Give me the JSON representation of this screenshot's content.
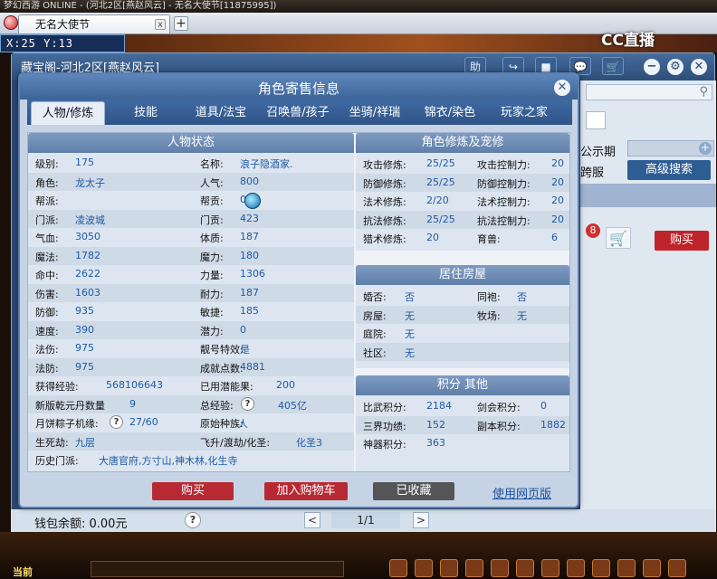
{
  "top_strip": "梦幻西游 ONLINE - (河北2区[燕赵风云] - 无名大使节[11875995])",
  "browser": {
    "tab_title": "无名大使节",
    "tab_close": "x",
    "new_tab": "+"
  },
  "coords": "X:25 Y:13",
  "watermark": "CC直播",
  "ig_window": {
    "title": "藏宝阁-河北2区[燕赵风云]",
    "icons": {
      "help": "助",
      "share": "↪",
      "stop": "■",
      "chat": "💬",
      "cart": "🛒",
      "minimize": "−",
      "settings": "⚙",
      "close": "✕"
    }
  },
  "right_panel": {
    "publicity_label": "公示期",
    "cross_server_label": "跨服",
    "advanced_search": "高级搜索",
    "badge_count": "8",
    "buy": "购买"
  },
  "bottom": {
    "wallet": "钱包余额: 0.00元",
    "help": "?",
    "prev": "<",
    "next": ">",
    "pager": "1/1"
  },
  "modal": {
    "title": "角色寄售信息",
    "close": "✕",
    "tabs": [
      "人物/修炼",
      "技能",
      "道具/法宝",
      "召唤兽/孩子",
      "坐骑/祥瑞",
      "锦衣/染色",
      "玩家之家"
    ],
    "status": {
      "header": "人物状态",
      "rows": [
        {
          "l1": "级别:",
          "v1": "175",
          "l2": "名称:",
          "v2": "浪子隐酒家."
        },
        {
          "l1": "角色:",
          "v1": "龙太子",
          "l2": "人气:",
          "v2": "800"
        },
        {
          "l1": "帮派:",
          "v1": "",
          "l2": "帮贡:",
          "v2": "0"
        },
        {
          "l1": "门派:",
          "v1": "凌波城",
          "l2": "门贡:",
          "v2": "423"
        },
        {
          "l1": "气血:",
          "v1": "3050",
          "l2": "体质:",
          "v2": "187"
        },
        {
          "l1": "魔法:",
          "v1": "1782",
          "l2": "魔力:",
          "v2": "180"
        },
        {
          "l1": "命中:",
          "v1": "2622",
          "l2": "力量:",
          "v2": "1306"
        },
        {
          "l1": "伤害:",
          "v1": "1603",
          "l2": "耐力:",
          "v2": "187"
        },
        {
          "l1": "防御:",
          "v1": "935",
          "l2": "敏捷:",
          "v2": "185"
        },
        {
          "l1": "速度:",
          "v1": "390",
          "l2": "潜力:",
          "v2": "0"
        },
        {
          "l1": "法伤:",
          "v1": "975",
          "l2": "靓号特效:",
          "v2": "是"
        },
        {
          "l1": "法防:",
          "v1": "975",
          "l2": "成就点数:",
          "v2": "4881"
        },
        {
          "l1": "获得经验:",
          "v1": "568106643",
          "l2": "已用潜能果:",
          "v2": "200"
        },
        {
          "l1": "新版乾元丹数量",
          "v1": "9",
          "l2": "总经验:",
          "v2": "405亿"
        },
        {
          "l1": "月饼粽子机缘:",
          "v1": "27/60",
          "l2": "原始种族:",
          "v2": "人"
        },
        {
          "l1": "生死劫:",
          "v1": "九层",
          "l2": "飞升/渡劫/化圣:",
          "v2": "化圣3"
        }
      ],
      "history_label": "历史门派:",
      "history_value": "大唐官府,方寸山,神木林,化生寺"
    },
    "cultivation": {
      "header": "角色修炼及宠修",
      "rows": [
        {
          "l1": "攻击修炼:",
          "v1": "25/25",
          "l2": "攻击控制力:",
          "v2": "20"
        },
        {
          "l1": "防御修炼:",
          "v1": "25/25",
          "l2": "防御控制力:",
          "v2": "20"
        },
        {
          "l1": "法术修炼:",
          "v1": "2/20",
          "l2": "法术控制力:",
          "v2": "20"
        },
        {
          "l1": "抗法修炼:",
          "v1": "25/25",
          "l2": "抗法控制力:",
          "v2": "20"
        },
        {
          "l1": "猎术修炼:",
          "v1": "20",
          "l2": "育兽:",
          "v2": "6"
        }
      ]
    },
    "housing": {
      "header": "居住房屋",
      "rows": [
        {
          "l1": "婚否:",
          "v1": "否",
          "l2": "同袍:",
          "v2": "否"
        },
        {
          "l1": "房屋:",
          "v1": "无",
          "l2": "牧场:",
          "v2": "无"
        },
        {
          "l1": "庭院:",
          "v1": "无",
          "l2": "",
          "v2": ""
        },
        {
          "l1": "社区:",
          "v1": "无",
          "l2": "",
          "v2": ""
        }
      ]
    },
    "points": {
      "header": "积分 其他",
      "rows": [
        {
          "l1": "比武积分:",
          "v1": "2184",
          "l2": "剑会积分:",
          "v2": "0"
        },
        {
          "l1": "三界功绩:",
          "v1": "152",
          "l2": "副本积分:",
          "v2": "1882"
        },
        {
          "l1": "神器积分:",
          "v1": "363",
          "l2": "",
          "v2": ""
        }
      ]
    },
    "buttons": {
      "buy": "购买",
      "add_cart": "加入购物车",
      "collected": "已收藏",
      "web": "使用网页版"
    }
  },
  "taskbar": {
    "current": "当前"
  },
  "colors": {
    "buy_red": "#b72a33",
    "collected_gray": "#555555",
    "link_blue": "#1b4fa0"
  }
}
